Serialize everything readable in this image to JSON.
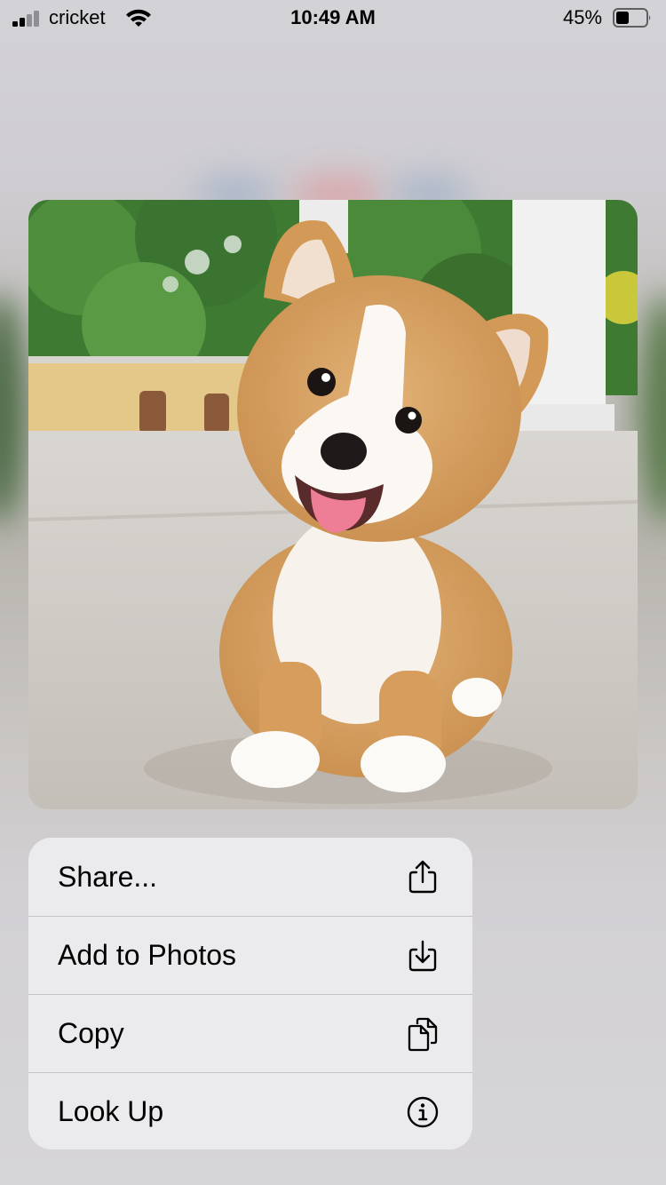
{
  "status_bar": {
    "carrier": "cricket",
    "time": "10:49 AM",
    "battery_percent": "45%",
    "signal_bars_active": 2,
    "signal_bars_total": 4,
    "battery_level": 0.45
  },
  "preview": {
    "subject": "corgi-puppy-photo"
  },
  "menu": {
    "items": [
      {
        "label": "Share...",
        "icon": "share-icon"
      },
      {
        "label": "Add to Photos",
        "icon": "save-to-photos-icon"
      },
      {
        "label": "Copy",
        "icon": "copy-icon"
      },
      {
        "label": "Look Up",
        "icon": "info-icon"
      }
    ]
  }
}
